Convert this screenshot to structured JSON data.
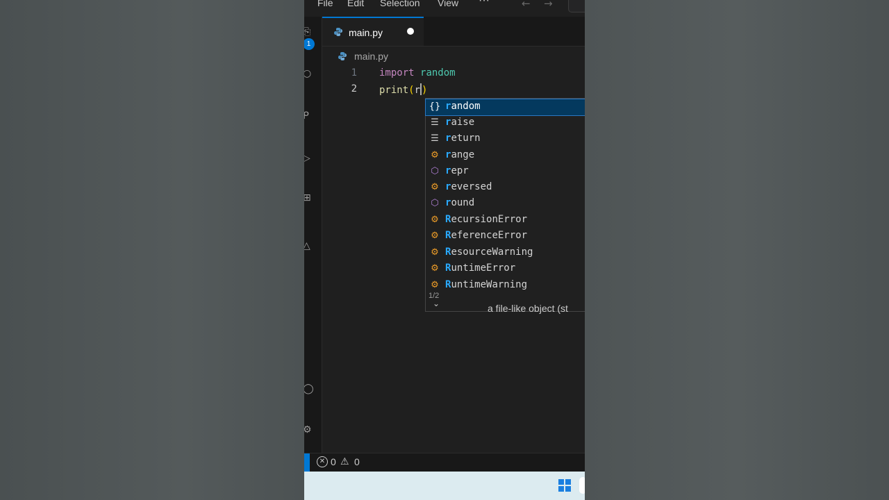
{
  "menu": {
    "items": [
      "File",
      "Edit",
      "Selection",
      "View"
    ],
    "more": "···"
  },
  "activity": {
    "badge_count": "1"
  },
  "tab": {
    "label": "main.py"
  },
  "breadcrumb": {
    "file": "main.py"
  },
  "editor": {
    "lines": [
      {
        "number": "1",
        "keyword": "import",
        "module": "random"
      },
      {
        "number": "2",
        "func": "print",
        "open": "(",
        "typed": "r",
        "close": ")"
      }
    ]
  },
  "suggestions": {
    "items": [
      {
        "match": "r",
        "rest": "andom",
        "kind": "module",
        "icon": "{}"
      },
      {
        "match": "r",
        "rest": "aise",
        "kind": "keyword",
        "icon": "keyword-icon"
      },
      {
        "match": "r",
        "rest": "eturn",
        "kind": "keyword",
        "icon": "keyword-icon"
      },
      {
        "match": "r",
        "rest": "ange",
        "kind": "class",
        "icon": "class-icon"
      },
      {
        "match": "r",
        "rest": "epr",
        "kind": "function",
        "icon": "cube-icon"
      },
      {
        "match": "r",
        "rest": "eversed",
        "kind": "class",
        "icon": "class-icon"
      },
      {
        "match": "r",
        "rest": "ound",
        "kind": "function",
        "icon": "cube-icon"
      },
      {
        "match": "R",
        "rest": "ecursionError",
        "kind": "class",
        "icon": "class-icon"
      },
      {
        "match": "R",
        "rest": "eferenceError",
        "kind": "class",
        "icon": "class-icon"
      },
      {
        "match": "R",
        "rest": "esourceWarning",
        "kind": "class",
        "icon": "class-icon"
      },
      {
        "match": "R",
        "rest": "untimeError",
        "kind": "class",
        "icon": "class-icon"
      },
      {
        "match": "R",
        "rest": "untimeWarning",
        "kind": "class",
        "icon": "class-icon"
      }
    ],
    "footer_count": "1/2",
    "doc_text": "a file-like object (st"
  },
  "status": {
    "errors": "0",
    "warnings": "0"
  },
  "colors": {
    "accent": "#0078d4",
    "selected_bg": "#04395e",
    "match_highlight": "#2aaaff",
    "class_icon": "#ee9d28",
    "function_icon": "#b180d7",
    "keyword": "#c586c0",
    "module": "#4ec9b0",
    "function": "#dcdcaa"
  }
}
